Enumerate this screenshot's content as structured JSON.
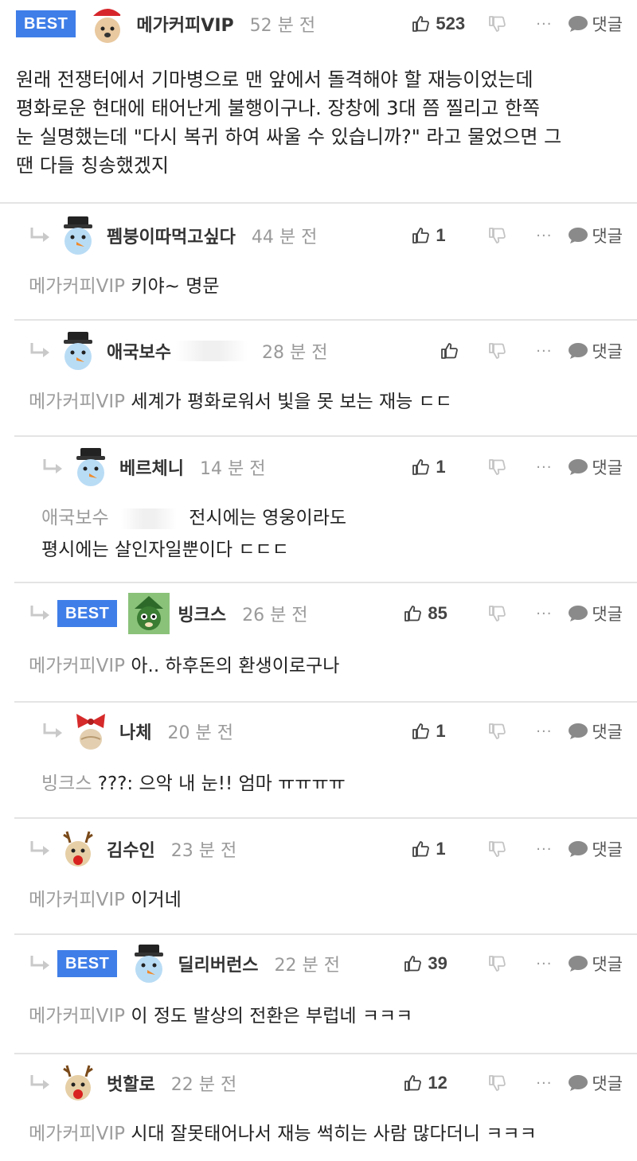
{
  "badge_best": "BEST",
  "reply_label": "댓글",
  "more_label": "···",
  "comments": [
    {
      "nick": "메가커피VIP",
      "time": "52 분 전",
      "likes": "523",
      "text_lines": [
        "원래 전쟁터에서 기마병으로 맨 앞에서 돌격해야 할 재능이었는데",
        "평화로운 현대에 태어난게 불행이구나. 장창에 3대 쯤 찔리고 한쪽",
        "눈 실명했는데 \"다시 복귀 하여 싸울 수 있습니까?\" 라고 물었으면 그",
        "땐 다들 칭송했겠지"
      ]
    },
    {
      "nick": "펨붕이따먹고싶다",
      "time": "44 분 전",
      "likes": "1",
      "mention": "메가커피VIP",
      "text": "키야~ 명문"
    },
    {
      "nick": "애국보수",
      "time": "28 분 전",
      "likes": "",
      "mention": "메가커피VIP",
      "text": "세계가 평화로워서 빛을 못 보는 재능 ㄷㄷ"
    },
    {
      "nick": "베르체니",
      "time": "14 분 전",
      "likes": "1",
      "mention": "애국보수",
      "text": "전시에는 영웅이라도",
      "text2": "평시에는 살인자일뿐이다 ㄷㄷㄷ"
    },
    {
      "nick": "빙크스",
      "time": "26 분 전",
      "likes": "85",
      "mention": "메가커피VIP",
      "text": "아.. 하후돈의 환생이로구나"
    },
    {
      "nick": "나체",
      "time": "20 분 전",
      "likes": "1",
      "mention": "빙크스",
      "text": "???: 으악 내 눈!! 엄마 ㅠㅠㅠㅠ"
    },
    {
      "nick": "김수인",
      "time": "23 분 전",
      "likes": "1",
      "mention": "메가커피VIP",
      "text": "이거네"
    },
    {
      "nick": "딜리버런스",
      "time": "22 분 전",
      "likes": "39",
      "mention": "메가커피VIP",
      "text": "이 정도 발상의 전환은 부럽네 ㅋㅋㅋ"
    },
    {
      "nick": "벗할로",
      "time": "22 분 전",
      "likes": "12",
      "mention": "메가커피VIP",
      "text": "시대 잘못태어나서 재능 썩히는 사람 많다더니 ㅋㅋㅋ"
    }
  ],
  "colors": {
    "best_badge": "#3f7ee8",
    "mention": "#9c9c9c",
    "divider": "#e4e4e4"
  },
  "icons": {
    "like": "thumbs-up-icon",
    "dislike": "thumbs-down-icon",
    "more": "more-dots-icon",
    "reply": "speech-bubble-icon",
    "reply_arrow": "reply-arrow-icon"
  }
}
